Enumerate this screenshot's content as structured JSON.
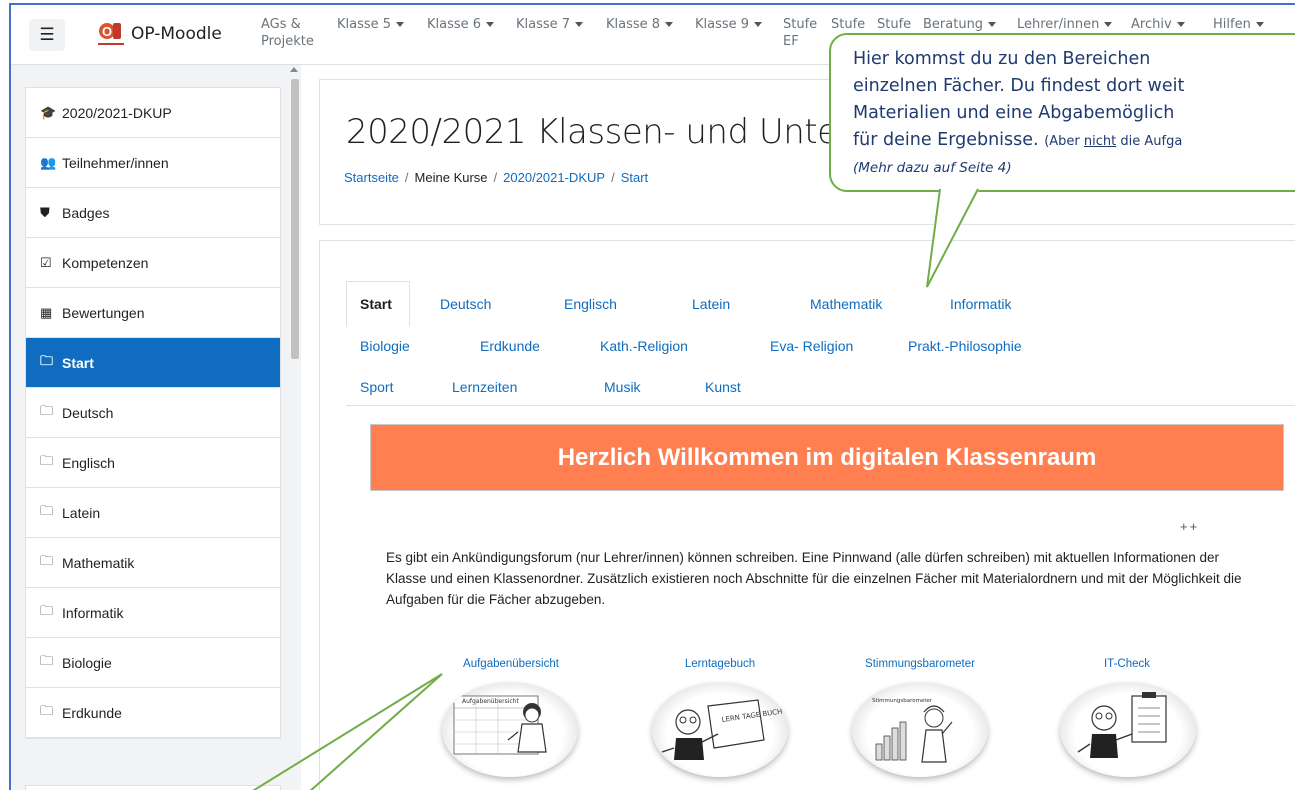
{
  "navbar": {
    "brand": "OP-Moodle",
    "items": [
      {
        "label_top": "AGs &",
        "label_bottom": "Projekte",
        "dropdown": false
      },
      {
        "label_top": "Klasse 5",
        "label_bottom": "",
        "dropdown": true
      },
      {
        "label_top": "Klasse 6",
        "label_bottom": "",
        "dropdown": true
      },
      {
        "label_top": "Klasse 7",
        "label_bottom": "",
        "dropdown": true
      },
      {
        "label_top": "Klasse 8",
        "label_bottom": "",
        "dropdown": true
      },
      {
        "label_top": "Klasse 9",
        "label_bottom": "",
        "dropdown": true
      },
      {
        "label_top": "Stufe",
        "label_bottom": "EF",
        "dropdown": false
      },
      {
        "label_top": "Stufe",
        "label_bottom": "",
        "dropdown": false
      },
      {
        "label_top": "Stufe",
        "label_bottom": "",
        "dropdown": false
      },
      {
        "label_top": "Beratung",
        "label_bottom": "",
        "dropdown": true
      },
      {
        "label_top": "Lehrer/innen",
        "label_bottom": "",
        "dropdown": true
      },
      {
        "label_top": "Archiv",
        "label_bottom": "",
        "dropdown": true
      },
      {
        "label_top": "Hilfen",
        "label_bottom": "",
        "dropdown": true
      }
    ]
  },
  "sidebar": {
    "items": [
      {
        "label": "2020/2021-DKUP",
        "icon": "graduation-cap-icon",
        "glyph": "🎓"
      },
      {
        "label": "Teilnehmer/innen",
        "icon": "users-icon",
        "glyph": "👥"
      },
      {
        "label": "Badges",
        "icon": "shield-icon",
        "glyph": "⛊"
      },
      {
        "label": "Kompetenzen",
        "icon": "checkbox-icon",
        "glyph": "☑"
      },
      {
        "label": "Bewertungen",
        "icon": "table-icon",
        "glyph": "▦"
      },
      {
        "label": "Start",
        "icon": "folder-icon",
        "glyph": "🗀",
        "active": true
      },
      {
        "label": "Deutsch",
        "icon": "folder-icon",
        "glyph": "🗀"
      },
      {
        "label": "Englisch",
        "icon": "folder-icon",
        "glyph": "🗀"
      },
      {
        "label": "Latein",
        "icon": "folder-icon",
        "glyph": "🗀"
      },
      {
        "label": "Mathematik",
        "icon": "folder-icon",
        "glyph": "🗀"
      },
      {
        "label": "Informatik",
        "icon": "folder-icon",
        "glyph": "🗀"
      },
      {
        "label": "Biologie",
        "icon": "folder-icon",
        "glyph": "🗀"
      },
      {
        "label": "Erdkunde",
        "icon": "folder-icon",
        "glyph": "🗀"
      }
    ]
  },
  "header": {
    "title": "2020/2021 Klassen- und Unte",
    "breadcrumb": [
      "Startseite",
      "Meine Kurse",
      "2020/2021-DKUP",
      "Start"
    ]
  },
  "tabs": {
    "row1": [
      "Start",
      "Deutsch",
      "Englisch",
      "Latein",
      "Mathematik",
      "Informatik"
    ],
    "row2": [
      "Biologie",
      "Erdkunde",
      "Kath.-Religion",
      "Eva- Religion",
      "Prakt.-Philosophie"
    ],
    "row3": [
      "Sport",
      "Lernzeiten",
      "Musik",
      "Kunst"
    ]
  },
  "content": {
    "banner": "Herzlich Willkommen im digitalen Klassenraum",
    "plus": "++",
    "intro": "Es gibt ein Ankündigungsforum (nur Lehrer/innen) können schreiben. Eine Pinnwand (alle dürfen schreiben) mit aktuellen Informationen der Klasse und einen Klassenordner. Zusätzlich existieren noch Abschnitte für die einzelnen Fächer mit Materialordnern und mit der Möglichkeit die Aufgaben für die Fächer abzugeben.",
    "links": [
      "Aufgabenübersicht",
      "Lerntagebuch",
      "Stimmungsbarometer",
      "IT-Check"
    ],
    "image_texts": [
      "Aufgabenübersicht",
      "LERN TAGE BUCH",
      "Stimmungsbarometer"
    ]
  },
  "callout": {
    "line1": "Hier kommst du zu den Bereichen",
    "line2": "einzelnen Fächer. Du findest dort weit",
    "line3": "Materialien und eine Abgabemöglich",
    "line4_main": "für deine Ergebnisse.",
    "line4_small_pre": "(Aber ",
    "line4_small_underline": "nicht",
    "line4_small_post": " die Aufga",
    "line5": "(Mehr dazu auf Seite 4)"
  },
  "colors": {
    "accent": "#0f6cbf",
    "banner": "#ff7f50",
    "callout_border": "#70ad47",
    "callout_text": "#1e3a70",
    "frame_border": "#4472c4"
  }
}
